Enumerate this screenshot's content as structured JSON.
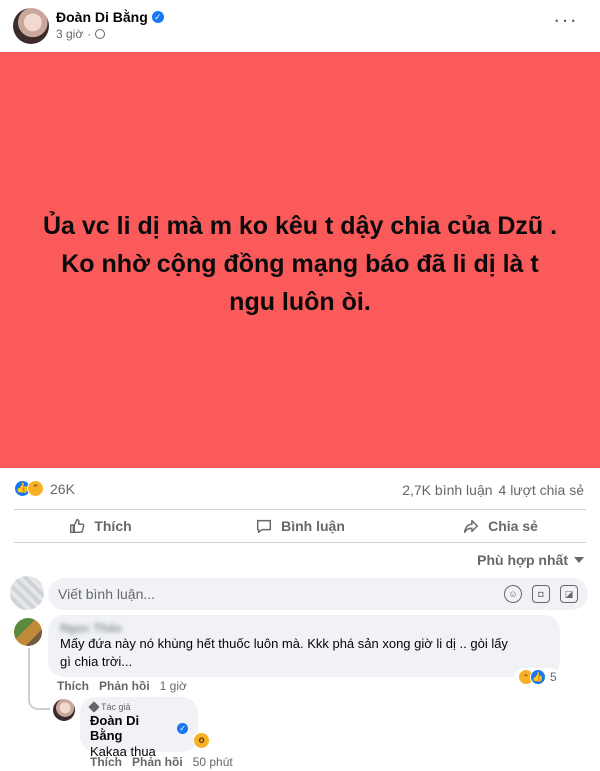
{
  "post": {
    "author": "Đoàn Di Bằng",
    "time": "3 giờ",
    "separator": "·",
    "more": "···",
    "text_lines": [
      "Ủa vc li dị mà m ko kêu t dậy chia của Dzũ .",
      "Ko nhờ cộng đồng mạng báo đã li dị là t",
      "ngu luôn òi."
    ],
    "background": "#fa5a5a"
  },
  "stats": {
    "reaction_count": "26K",
    "comments": "2,7K bình luận",
    "shares": "4 lượt chia sẻ"
  },
  "actions": {
    "like": "Thích",
    "comment": "Bình luận",
    "share": "Chia sẻ"
  },
  "sort": {
    "label": "Phù hợp nhất"
  },
  "composer": {
    "placeholder": "Viết bình luận..."
  },
  "comments": [
    {
      "name": "Ngọc Thảo",
      "text_lines": [
        "Mấy đứa này nó khùng hết thuốc luôn mà. Kkk phá sản xong giờ li dị .. gòi lấy",
        "gì chia trời..."
      ],
      "like_label": "Thích",
      "reply_label": "Phản hồi",
      "time": "1 giờ",
      "reaction_count": "5"
    }
  ],
  "reply": {
    "badge": "Tác giả",
    "name": "Đoàn Di Bằng",
    "text": "Kakaa thua",
    "like_label": "Thích",
    "reply_label": "Phản hồi",
    "time": "50 phút"
  },
  "colors": {
    "accent": "#1877f2",
    "post_bg": "#fa5a5a",
    "muted": "#65676b"
  }
}
